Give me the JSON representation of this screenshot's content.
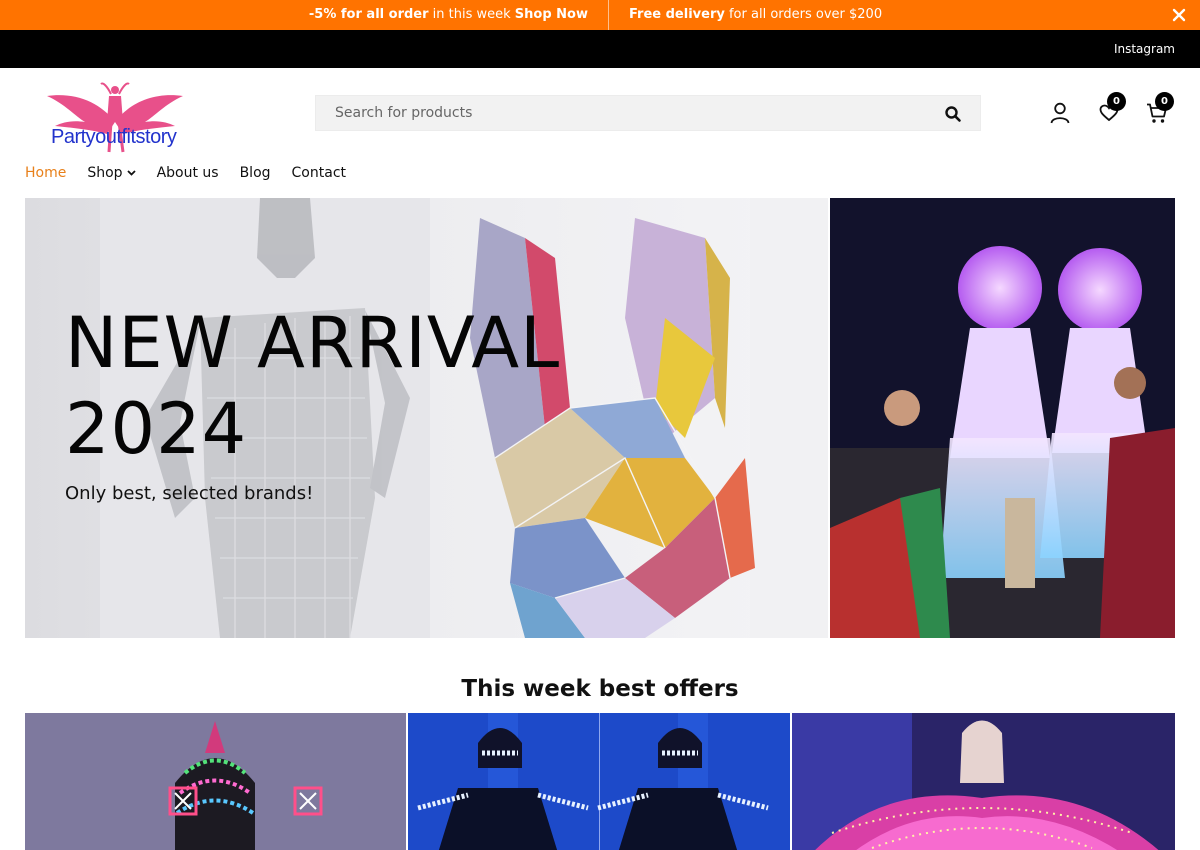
{
  "promo": {
    "left_highlight": "-5% for all order",
    "left_rest": "in this week",
    "left_link": "Shop Now",
    "right_highlight": "Free delivery",
    "right_rest": "for all orders over $200"
  },
  "topbar": {
    "social_link": "Instagram"
  },
  "logo": {
    "text": "Partyoutfitstory"
  },
  "search": {
    "placeholder": "Search for products"
  },
  "header": {
    "wishlist_count": "0",
    "cart_count": "0"
  },
  "nav": {
    "items": [
      {
        "label": "Home",
        "active": true
      },
      {
        "label": "Shop",
        "has_dropdown": true
      },
      {
        "label": "About us"
      },
      {
        "label": "Blog"
      },
      {
        "label": "Contact"
      }
    ]
  },
  "hero": {
    "title_line1": "NEW ARRIVAL",
    "title_line2": "2024",
    "subtitle": "Only best, selected brands!"
  },
  "offers": {
    "title": "This week best offers"
  },
  "colors": {
    "promo_bg": "#ff7300",
    "topbar_bg": "#000000",
    "nav_active": "#e8801a",
    "logo_pink": "#e8508a",
    "logo_blue": "#2233cc"
  },
  "icons": [
    "close-icon",
    "search-icon",
    "user-icon",
    "heart-icon",
    "cart-icon",
    "chevron-down-icon"
  ]
}
